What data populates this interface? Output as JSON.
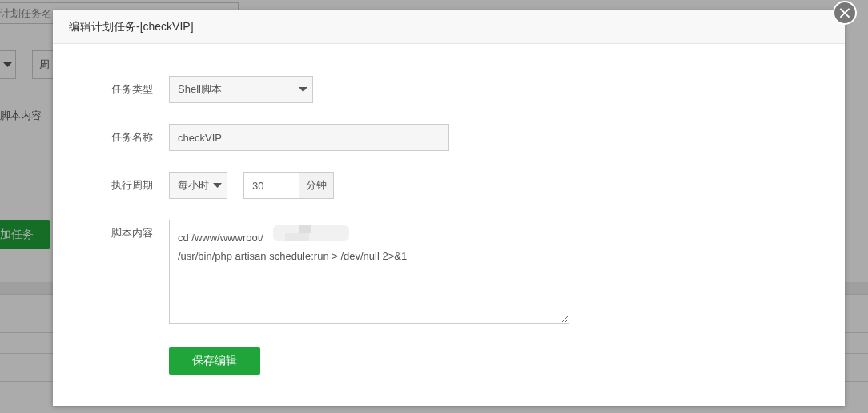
{
  "background": {
    "name_field": "计划任务名",
    "period_field": "周",
    "script_label": "脚本内容",
    "add_button": "加任务"
  },
  "dialog": {
    "title": "编辑计划任务-[checkVIP]",
    "close": "×",
    "fields": [
      {
        "kind": "select",
        "label": "任务类型",
        "value": "Shell脚本"
      },
      {
        "kind": "text",
        "label": "任务名称",
        "value": "checkVIP"
      },
      {
        "kind": "period",
        "label": "执行周期",
        "value": "每小时",
        "minutes": "30",
        "unit": "分钟"
      },
      {
        "kind": "textarea",
        "label": "脚本内容",
        "value": "cd /www/wwwroot/\n/usr/bin/php artisan schedule:run > /dev/null 2>&1"
      }
    ],
    "save_button": "保存编辑"
  }
}
